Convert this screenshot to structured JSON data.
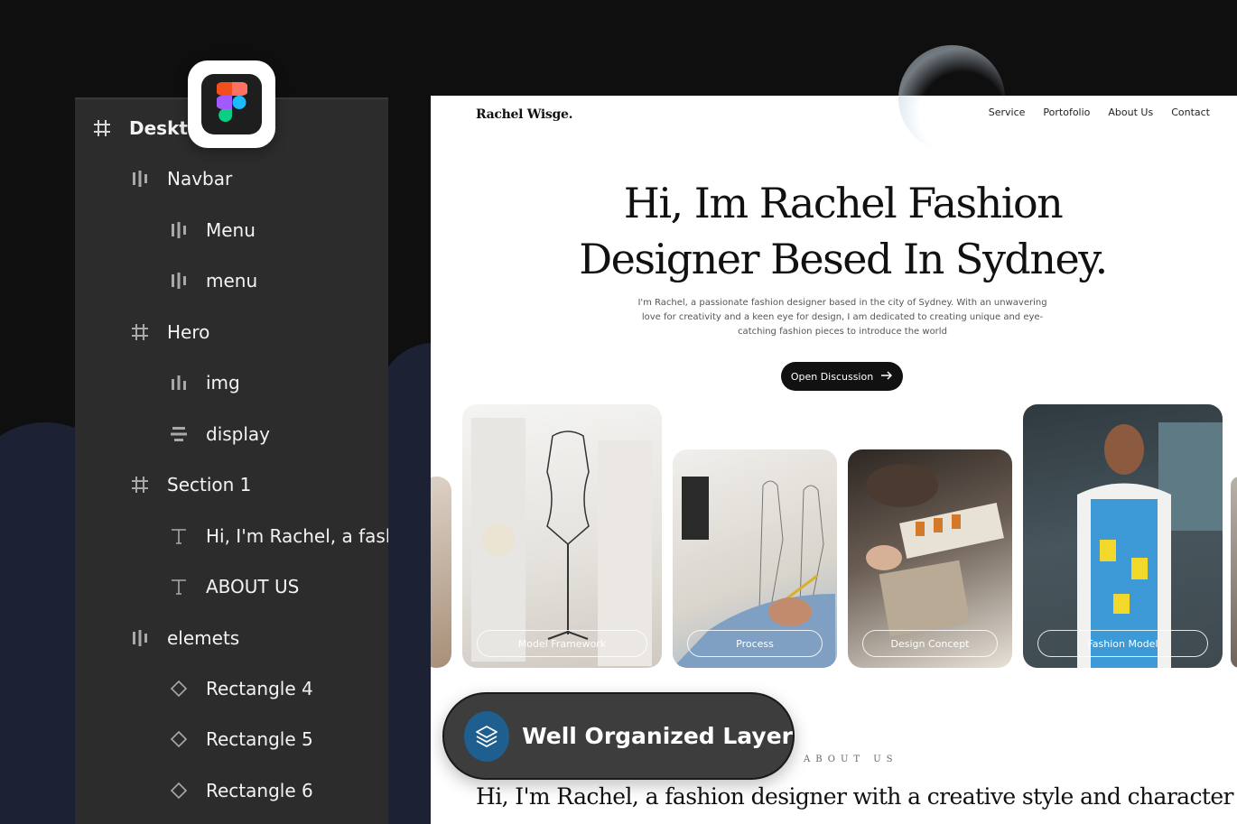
{
  "layers": {
    "items": [
      {
        "label": "Desktop",
        "icon": "frame-icon"
      },
      {
        "label": "Navbar",
        "icon": "autolayout-horizontal-icon"
      },
      {
        "label": "Menu",
        "icon": "autolayout-horizontal-icon"
      },
      {
        "label": "menu",
        "icon": "autolayout-horizontal-icon"
      },
      {
        "label": "Hero",
        "icon": "frame-icon"
      },
      {
        "label": "img",
        "icon": "autolayout-horizontal-icon"
      },
      {
        "label": "display",
        "icon": "autolayout-vertical-icon"
      },
      {
        "label": "Section 1",
        "icon": "frame-icon"
      },
      {
        "label": "Hi, I'm Rachel, a fashion designer",
        "icon": "text-icon"
      },
      {
        "label": "ABOUT US",
        "icon": "text-icon"
      },
      {
        "label": "elemets",
        "icon": "autolayout-horizontal-icon"
      },
      {
        "label": "Rectangle 4",
        "icon": "rectangle-icon"
      },
      {
        "label": "Rectangle 5",
        "icon": "rectangle-icon"
      },
      {
        "label": "Rectangle 6",
        "icon": "rectangle-icon"
      }
    ]
  },
  "badge": {
    "icon": "figma-logo-icon"
  },
  "site": {
    "logo": "Rachel Wisge.",
    "nav": [
      "Service",
      "Portofolio",
      "About Us",
      "Contact"
    ],
    "hero_line1": "Hi, Im Rachel Fashion",
    "hero_line2": "Designer Besed In Sydney.",
    "hero_desc": "I'm Rachel, a passionate fashion designer based in the city of Sydney. With an unwavering love for creativity and a keen eye for design, I am dedicated to creating unique and eye-catching fashion pieces to introduce the world",
    "cta_label": "Open Discussion",
    "cards": [
      {
        "label": "Model Framework"
      },
      {
        "label": "Process"
      },
      {
        "label": "Design Concept"
      },
      {
        "label": "Fashion Model"
      }
    ],
    "about_label": "ABOUT US",
    "about_text": "Hi, I'm Rachel, a fashion designer with a creative style and character in"
  },
  "floating_badge": {
    "label": "Well Organized Layer",
    "icon": "layers-icon"
  },
  "colors": {
    "panel": "#2c2c2c",
    "badge_accent": "#1f5f8f",
    "cta": "#111111"
  }
}
